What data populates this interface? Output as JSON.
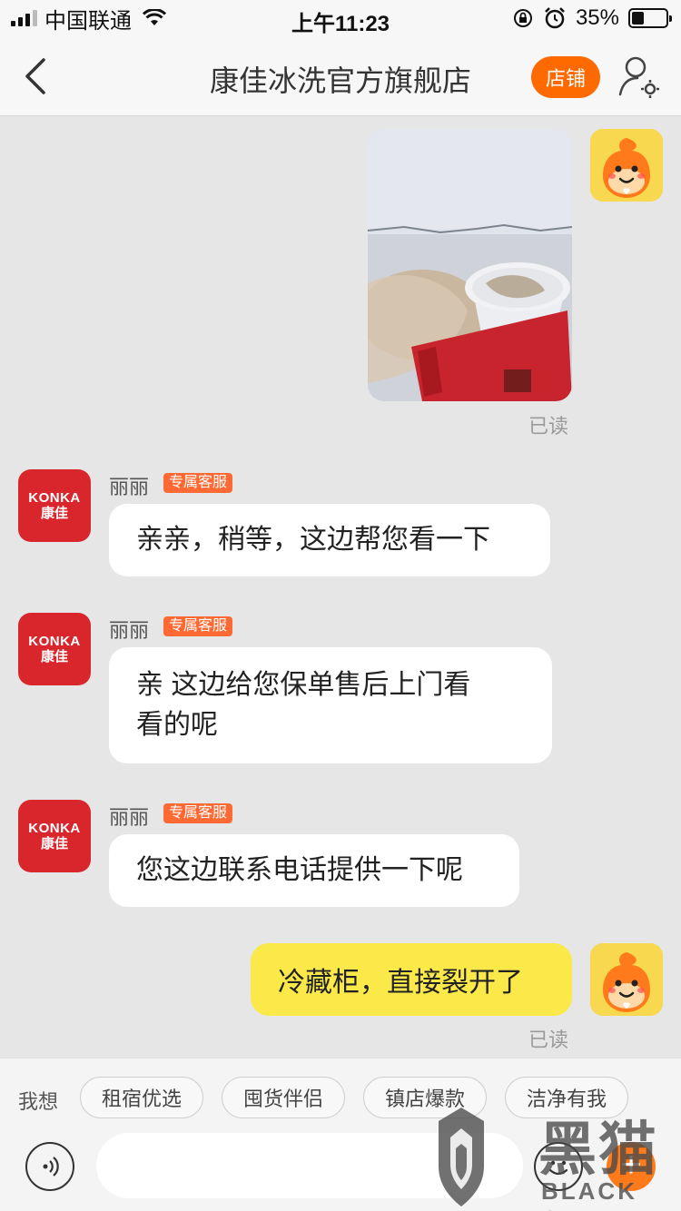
{
  "status_bar": {
    "carrier": "中国联通",
    "time": "上午11:23",
    "battery_percent": "35%",
    "battery_level": 0.35
  },
  "nav": {
    "title": "康佳冰洗官方旗舰店",
    "store_label": "店铺"
  },
  "messages": {
    "photo": {
      "read_status": "已读"
    },
    "agent": [
      {
        "sender": "丽丽",
        "badge": "专属客服",
        "avatar_top": "KONKA",
        "avatar_bottom": "康佳",
        "text": "亲亲，稍等，这边帮您看一下"
      },
      {
        "sender": "丽丽",
        "badge": "专属客服",
        "avatar_top": "KONKA",
        "avatar_bottom": "康佳",
        "line1": "亲 这边给您保单售后上门看",
        "line2": "看的呢"
      },
      {
        "sender": "丽丽",
        "badge": "专属客服",
        "avatar_top": "KONKA",
        "avatar_bottom": "康佳",
        "text": "您这边联系电话提供一下呢"
      }
    ],
    "user_text": {
      "text": "冷藏柜，直接裂开了",
      "read_status": "已读"
    }
  },
  "quick_replies": {
    "label": "我想",
    "chips": [
      "租宿优选",
      "囤货伴侣",
      "镇店爆款",
      "洁净有我"
    ]
  },
  "watermark": {
    "line1": "黑猫",
    "line2": "BLACK CAT"
  },
  "colors": {
    "accent": "#ff6a00",
    "konka_red": "#d9262c",
    "user_bubble": "#fbe94a",
    "badge": "#ff6a34",
    "background": "#e6e6e6"
  }
}
